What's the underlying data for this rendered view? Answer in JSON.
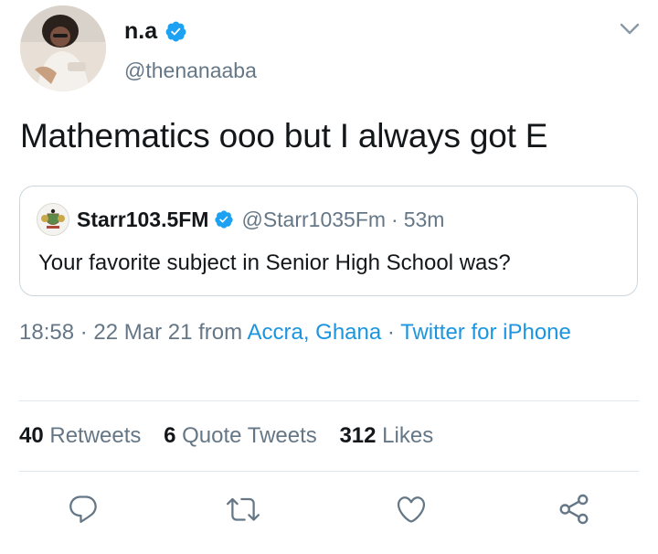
{
  "author": {
    "display_name": "n.a",
    "handle": "@thenanaaba",
    "verified": true
  },
  "tweet": {
    "text": "Mathematics ooo but I always got E"
  },
  "quoted_tweet": {
    "display_name": "Starr103.5FM",
    "handle": "@Starr1035Fm",
    "separator": "·",
    "time_ago": "53m",
    "text": "Your favorite subject in Senior High School was?",
    "verified": true
  },
  "meta": {
    "time": "18:58",
    "sep1": " · ",
    "date": "22 Mar 21",
    "from_label": " from ",
    "location": "Accra, Ghana",
    "sep2": " · ",
    "source": "Twitter for iPhone"
  },
  "stats": {
    "retweets_count": "40",
    "retweets_label": "Retweets",
    "quotes_count": "6",
    "quotes_label": "Quote Tweets",
    "likes_count": "312",
    "likes_label": "Likes"
  },
  "actions": [
    {
      "icon": "reply-icon"
    },
    {
      "icon": "retweet-icon"
    },
    {
      "icon": "like-icon"
    },
    {
      "icon": "share-icon"
    }
  ],
  "colors": {
    "accent": "#1da1f2",
    "link": "#1b95e0",
    "secondary_text": "#657786",
    "icon": "#657786"
  }
}
